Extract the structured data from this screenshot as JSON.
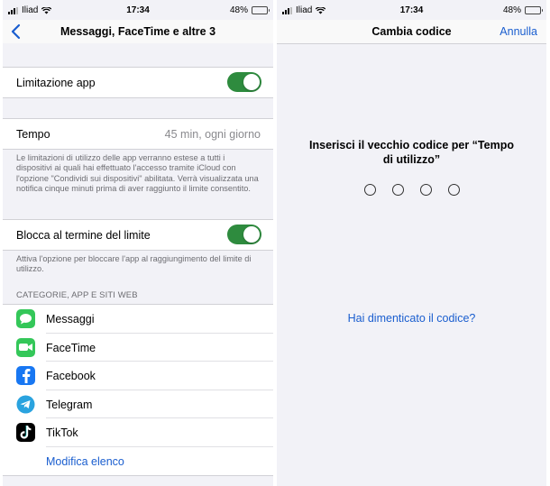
{
  "left": {
    "status": {
      "carrier": "Iliad",
      "time": "17:34",
      "battery": "48%",
      "battery_level": 0.48
    },
    "nav": {
      "back_icon": "chevron-left-icon",
      "title": "Messaggi, FaceTime e altre 3"
    },
    "app_limit": {
      "label": "Limitazione app",
      "enabled": true
    },
    "time": {
      "label": "Tempo",
      "value": "45 min, ogni giorno"
    },
    "time_note": "Le limitazioni di utilizzo delle app verranno estese a tutti i dispositivi ai quali hai effettuato l'accesso tramite iCloud con l'opzione \"Condividi sui dispositivi\" abilitata. Verrà visualizzata una notifica cinque minuti prima di aver raggiunto il limite consentito.",
    "block": {
      "label": "Blocca al termine del limite",
      "enabled": true
    },
    "block_note": "Attiva l'opzione per bloccare l'app al raggiungimento del limite di utilizzo.",
    "section_header": "CATEGORIE, APP E SITI WEB",
    "apps": [
      {
        "name": "Messaggi",
        "icon": "messages-icon",
        "color": "#34c759"
      },
      {
        "name": "FaceTime",
        "icon": "facetime-icon",
        "color": "#34c759"
      },
      {
        "name": "Facebook",
        "icon": "facebook-icon",
        "color": "#1877f2"
      },
      {
        "name": "Telegram",
        "icon": "telegram-icon",
        "color": "#2aa3df"
      },
      {
        "name": "TikTok",
        "icon": "tiktok-icon",
        "color": "#000000"
      }
    ],
    "edit_link": "Modifica elenco"
  },
  "right": {
    "status": {
      "carrier": "Iliad",
      "time": "17:34",
      "battery": "48%",
      "battery_level": 0.48
    },
    "nav": {
      "title": "Cambia codice",
      "cancel": "Annulla"
    },
    "prompt": "Inserisci il vecchio codice per “Tempo di utilizzo”",
    "passcode_digits": 4,
    "forgot": "Hai dimenticato il codice?"
  },
  "colors": {
    "accent": "#1a5ecf",
    "toggle_on": "#2e8b3e",
    "background": "#f2f2f7"
  }
}
